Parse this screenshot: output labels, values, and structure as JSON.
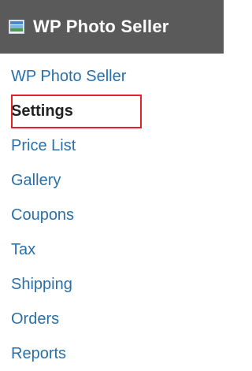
{
  "header": {
    "title": "WP Photo Seller",
    "icon": "gallery-icon"
  },
  "menu": {
    "items": [
      {
        "label": "WP Photo Seller"
      },
      {
        "label": "Settings",
        "current": true
      },
      {
        "label": "Price List"
      },
      {
        "label": "Gallery"
      },
      {
        "label": "Coupons"
      },
      {
        "label": "Tax"
      },
      {
        "label": "Shipping"
      },
      {
        "label": "Orders"
      },
      {
        "label": "Reports"
      }
    ]
  },
  "colors": {
    "header_bg": "#5a5a5a",
    "link": "#2a6fa8",
    "current": "#222222",
    "highlight": "#e0222a"
  }
}
